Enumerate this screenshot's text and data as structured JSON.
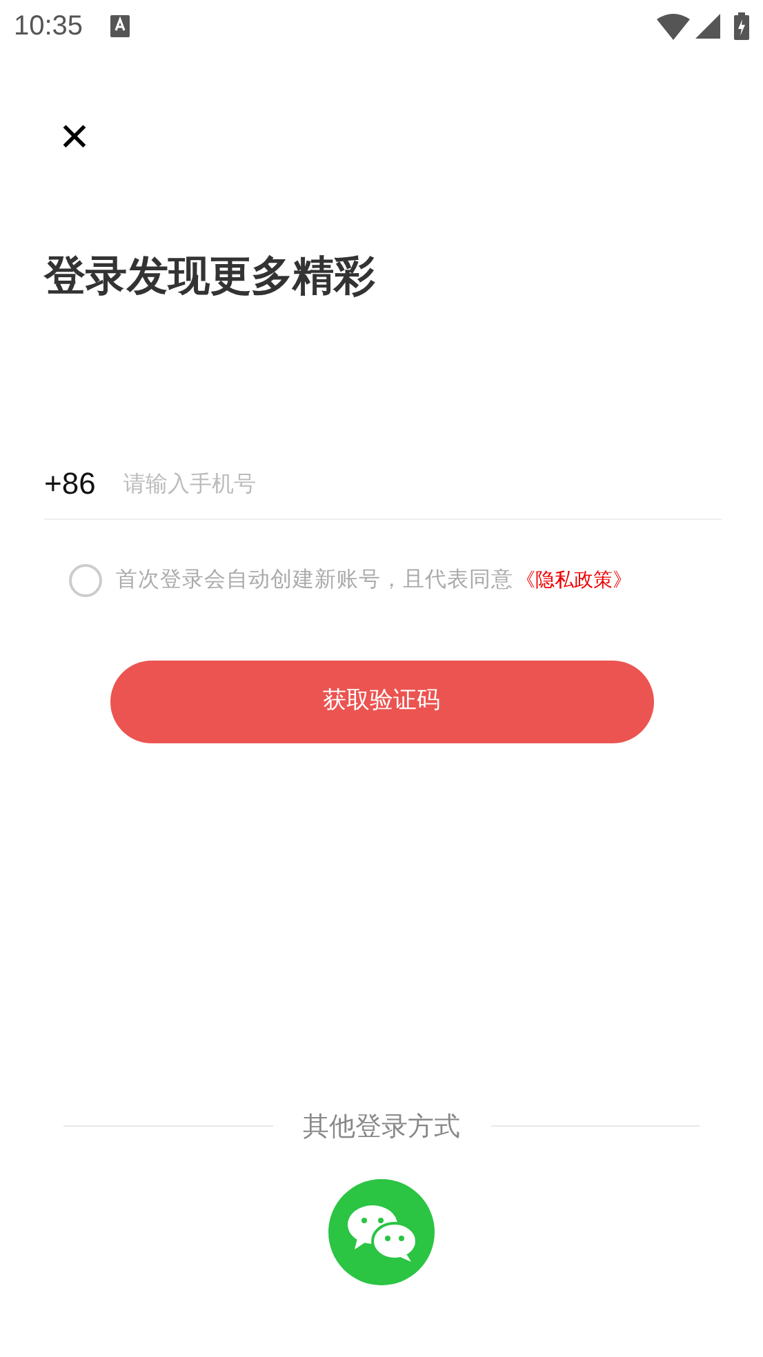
{
  "status_bar": {
    "time": "10:35"
  },
  "close": {
    "glyph": "✕"
  },
  "title": "登录发现更多精彩",
  "phone": {
    "prefix": "+86",
    "placeholder": "请输入手机号"
  },
  "agreement": {
    "checked": false,
    "text": "首次登录会自动创建新账号，且代表同意",
    "link": "《隐私政策》"
  },
  "submit": {
    "label": "获取验证码"
  },
  "other_login": {
    "label": "其他登录方式"
  }
}
